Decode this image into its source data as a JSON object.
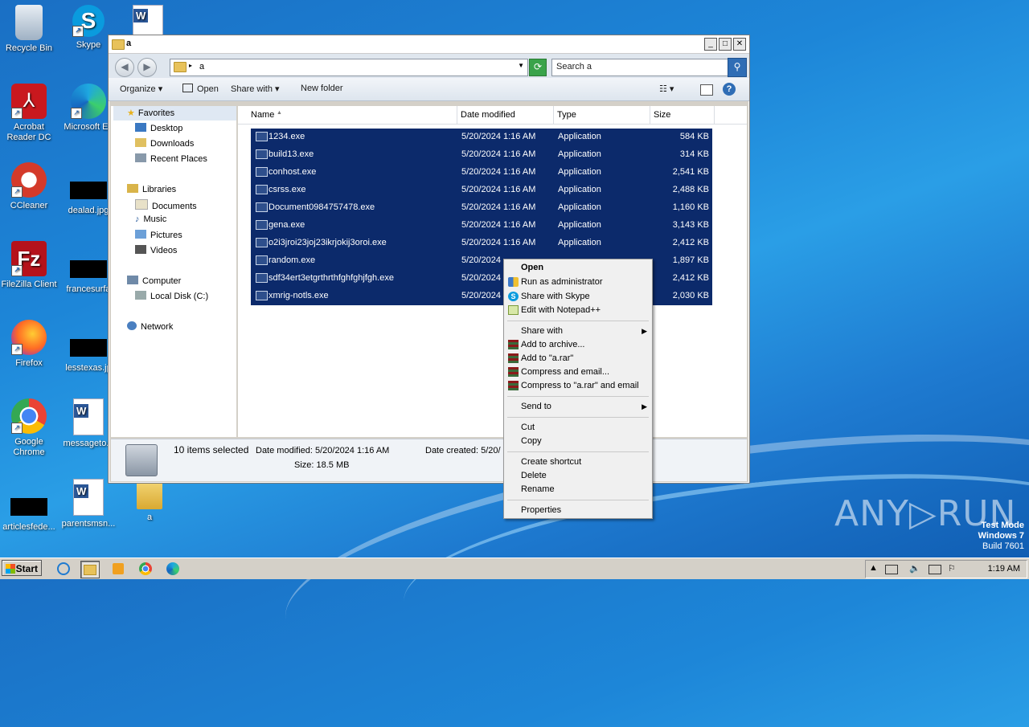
{
  "desktop": {
    "icons": [
      {
        "label": "Recycle Bin"
      },
      {
        "label": "Skype"
      },
      {
        "label": "Acrobat Reader DC"
      },
      {
        "label": "Microsoft Ed"
      },
      {
        "label": "CCleaner"
      },
      {
        "label": "dealad.jpg"
      },
      {
        "label": "FileZilla Client"
      },
      {
        "label": "francesurfa"
      },
      {
        "label": "Firefox"
      },
      {
        "label": "lesstexas.jp"
      },
      {
        "label": "Google Chrome"
      },
      {
        "label": "messageto..."
      },
      {
        "label": "articlesfede..."
      },
      {
        "label": "parentsmsn..."
      },
      {
        "label": "a"
      }
    ]
  },
  "window": {
    "title": "a",
    "address": "a",
    "search_placeholder": "Search a",
    "toolbar": {
      "organize": "Organize",
      "open": "Open",
      "share_with": "Share with",
      "new_folder": "New folder"
    },
    "nav": {
      "favorites": "Favorites",
      "desktop": "Desktop",
      "downloads": "Downloads",
      "recent": "Recent Places",
      "libraries": "Libraries",
      "documents": "Documents",
      "music": "Music",
      "pictures": "Pictures",
      "videos": "Videos",
      "computer": "Computer",
      "local_disk": "Local Disk (C:)",
      "network": "Network"
    },
    "columns": {
      "name": "Name",
      "date": "Date modified",
      "type": "Type",
      "size": "Size"
    },
    "files": [
      {
        "name": "1234.exe",
        "date": "5/20/2024 1:16 AM",
        "type": "Application",
        "size": "584 KB"
      },
      {
        "name": "build13.exe",
        "date": "5/20/2024 1:16 AM",
        "type": "Application",
        "size": "314 KB"
      },
      {
        "name": "conhost.exe",
        "date": "5/20/2024 1:16 AM",
        "type": "Application",
        "size": "2,541 KB"
      },
      {
        "name": "csrss.exe",
        "date": "5/20/2024 1:16 AM",
        "type": "Application",
        "size": "2,488 KB"
      },
      {
        "name": "Document0984757478.exe",
        "date": "5/20/2024 1:16 AM",
        "type": "Application",
        "size": "1,160 KB"
      },
      {
        "name": "gena.exe",
        "date": "5/20/2024 1:16 AM",
        "type": "Application",
        "size": "3,143 KB"
      },
      {
        "name": "o2i3jroi23joj23ikrjokij3oroi.exe",
        "date": "5/20/2024 1:16 AM",
        "type": "Application",
        "size": "2,412 KB"
      },
      {
        "name": "random.exe",
        "date": "5/20/2024",
        "type": "",
        "size": "1,897 KB"
      },
      {
        "name": "sdf34ert3etgrthrthfghfghjfgh.exe",
        "date": "5/20/2024",
        "type": "",
        "size": "2,412 KB"
      },
      {
        "name": "xmrig-notls.exe",
        "date": "5/20/2024",
        "type": "",
        "size": "2,030 KB"
      }
    ],
    "status": {
      "selected": "10 items selected",
      "date_modified": "Date modified: 5/20/2024 1:16 AM",
      "date_created": "Date created: 5/20/",
      "size": "Size: 18.5 MB"
    }
  },
  "context_menu": {
    "open": "Open",
    "run_admin": "Run as administrator",
    "share_skype": "Share with Skype",
    "edit_notepad": "Edit with Notepad++",
    "share_with": "Share with",
    "add_archive": "Add to archive...",
    "add_rar": "Add to \"a.rar\"",
    "compress_email": "Compress and email...",
    "compress_rar_email": "Compress to \"a.rar\" and email",
    "send_to": "Send to",
    "cut": "Cut",
    "copy": "Copy",
    "create_shortcut": "Create shortcut",
    "delete": "Delete",
    "rename": "Rename",
    "properties": "Properties"
  },
  "taskbar": {
    "start": "Start",
    "clock": "1:19 AM"
  },
  "watermark": {
    "line1": "Test Mode",
    "line2": "Windows 7",
    "line3": "Build 7601",
    "brand": "ANY▷RUN"
  }
}
